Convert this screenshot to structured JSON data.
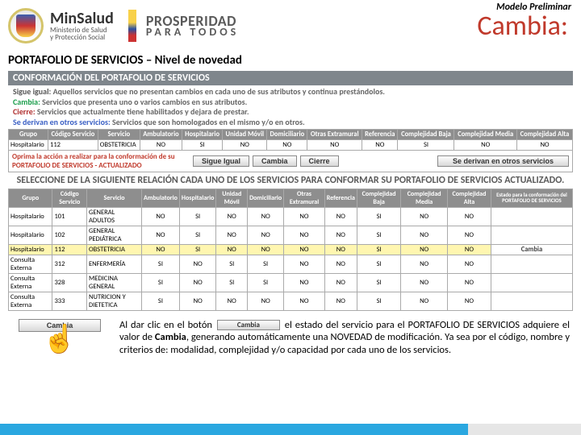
{
  "meta": {
    "preliminar": "Modelo Preliminar"
  },
  "header": {
    "brand": "MinSalud",
    "sub1": "Ministerio de Salud",
    "sub2": "y Protección Social",
    "prosperidad1": "PROSPERIDAD",
    "prosperidad2": "PARA TODOS",
    "cambia": "Cambia:"
  },
  "breadcrumb": "PORTAFOLIO DE SERVICIOS – Nivel de novedad",
  "band": "CONFORMACIÓN DEL PORTAFOLIO DE SERVICIOS",
  "legend": {
    "si_l": "Sigue igual:",
    "si_t": "Aquellos servicios que no presentan cambios en cada uno de sus atributos y continua prestándolos.",
    "ca_l": "Cambia:",
    "ca_t": "Servicios que presenta uno o varios cambios en sus atributos.",
    "ci_l": "Cierre:",
    "ci_t": "Servicios que actualmente tiene habilitados y dejara de prestar.",
    "se_l": "Se derivan en otros servicios:",
    "se_t": "Servicios que son homologados en el mismo y/o en otros."
  },
  "t1": {
    "headers": [
      "Grupo",
      "Código Servicio",
      "Servicio",
      "Ambulatorio",
      "Hospitalario",
      "Unidad Móvil",
      "Domiciliario",
      "Otras Extramural",
      "Referencia",
      "Complejidad Baja",
      "Complejidad Media",
      "Complejidad Alta"
    ],
    "row": [
      "Hospitalario",
      "112",
      "OBSTETRICIA",
      "NO",
      "SI",
      "NO",
      "NO",
      "NO",
      "NO",
      "SI",
      "NO",
      "NO"
    ]
  },
  "oprima": {
    "line1": "Oprima la acción a realizar para la conformación de su",
    "line2": "PORTAFOLIO DE SERVICIOS - ACTUALIZADO",
    "btns": {
      "sigue": "Sigue Igual",
      "cambia": "Cambia",
      "cierre": "Cierre",
      "deriva": "Se derivan en otros servicios"
    }
  },
  "relacion": "SELECCIONE DE LA SIGUIENTE RELACIÓN CADA UNO DE LOS SERVICIOS PARA CONFORMAR SU PORTAFOLIO DE SERVICIOS ACTUALIZADO.",
  "t2": {
    "headers": [
      "Grupo",
      "Código Servicio",
      "Servicio",
      "Ambulatorio",
      "Hospitalario",
      "Unidad Móvil",
      "Domiciliario",
      "Otras Extramural",
      "Referencia",
      "Complejidad Baja",
      "Complejidad Media",
      "Complejidad Alta"
    ],
    "estado_hd": "Estado para la conformación del PORTAFOLIO DE SERVICIOS",
    "rows": [
      [
        "Hospitalario",
        "101",
        "GENERAL ADULTOS",
        "NO",
        "SI",
        "NO",
        "NO",
        "NO",
        "NO",
        "SI",
        "NO",
        "NO",
        ""
      ],
      [
        "Hospitalario",
        "102",
        "GENERAL PEDIÁTRICA",
        "NO",
        "SI",
        "NO",
        "NO",
        "NO",
        "NO",
        "SI",
        "NO",
        "NO",
        ""
      ],
      [
        "Hospitalario",
        "112",
        "OBSTETRICIA",
        "NO",
        "SI",
        "NO",
        "NO",
        "NO",
        "NO",
        "SI",
        "NO",
        "NO",
        "Cambia"
      ],
      [
        "Consulta Externa",
        "312",
        "ENFERMERÍA",
        "SI",
        "NO",
        "SI",
        "SI",
        "NO",
        "NO",
        "SI",
        "NO",
        "NO",
        ""
      ],
      [
        "Consulta Externa",
        "328",
        "MEDICINA GENERAL",
        "SI",
        "NO",
        "SI",
        "SI",
        "NO",
        "NO",
        "SI",
        "NO",
        "NO",
        ""
      ],
      [
        "Consulta Externa",
        "333",
        "NUTRICION Y DIETETICA",
        "SI",
        "NO",
        "NO",
        "NO",
        "NO",
        "NO",
        "SI",
        "NO",
        "NO",
        ""
      ]
    ]
  },
  "explain": {
    "pre": "Al dar clic en el botón",
    "mid": "el estado del servicio para el PORTAFOLIO DE SERVICIOS  adquiere el valor de ",
    "bold": "Cambia",
    "post": ", generando automáticamente una NOVEDAD de modificación. Ya sea por el código, nombre y criterios de: modalidad, complejidad y/o capacidad por cada uno de los servicios."
  },
  "demo_btn": "Cambia",
  "inline_btn": "Cambia"
}
